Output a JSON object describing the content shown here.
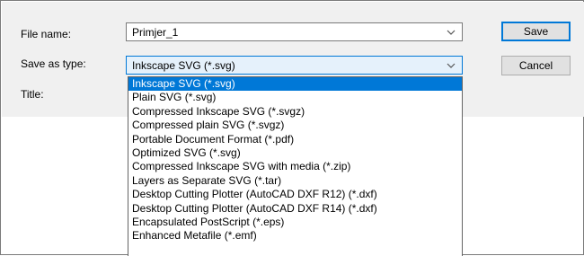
{
  "fields": {
    "file_name_label": "File name:",
    "file_name_value": "Primjer_1",
    "save_as_type_label": "Save as type:",
    "save_as_type_value": "Inkscape SVG (*.svg)",
    "title_label": "Title:"
  },
  "buttons": {
    "save": "Save",
    "cancel": "Cancel"
  },
  "dropdown": {
    "selected_index": 0,
    "options": [
      "Inkscape SVG (*.svg)",
      "Plain SVG (*.svg)",
      "Compressed Inkscape SVG (*.svgz)",
      "Compressed plain SVG (*.svgz)",
      "Portable Document Format (*.pdf)",
      "Optimized SVG (*.svg)",
      "Compressed Inkscape SVG with media (*.zip)",
      "Layers as Separate SVG (*.tar)",
      "Desktop Cutting Plotter (AutoCAD DXF R12) (*.dxf)",
      "Desktop Cutting Plotter (AutoCAD DXF R14) (*.dxf)",
      "Encapsulated PostScript (*.eps)",
      "Enhanced Metafile (*.emf)"
    ]
  },
  "colors": {
    "selection": "#0078d7",
    "panel": "#f0f0f0"
  },
  "icons": {
    "dropdown_arrow": "chevron-down-icon"
  }
}
